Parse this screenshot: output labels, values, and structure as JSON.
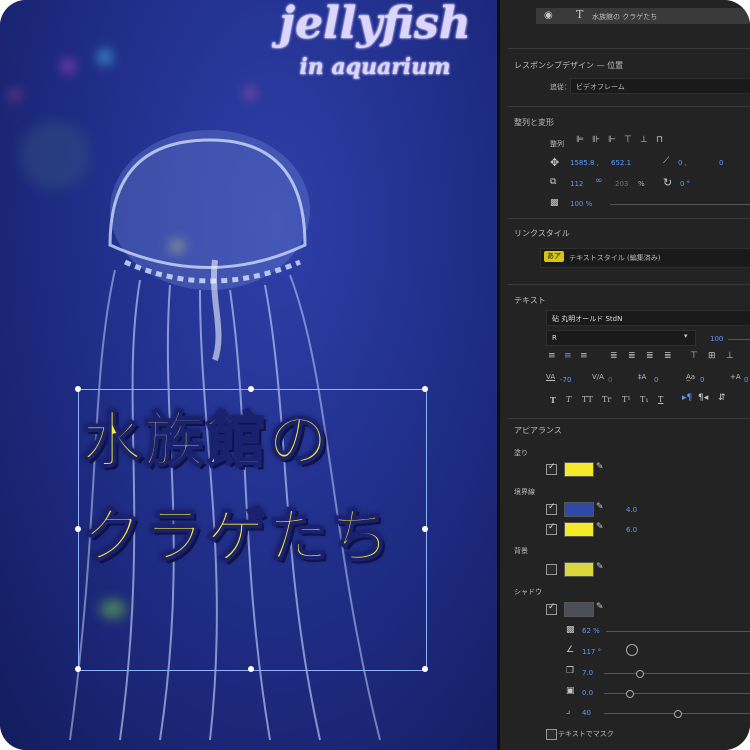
{
  "preview": {
    "logo_title": "jellyfish",
    "logo_subtitle": "in aquarium",
    "caption_line1": "水族館の",
    "caption_line2": "クラゲたち"
  },
  "layer": {
    "name": "水族館の クラゲたち",
    "type_icon": "T"
  },
  "responsive": {
    "title": "レスポンシブデザイン — 位置",
    "follow_label": "追従：",
    "follow_value": "ビデオフレーム"
  },
  "transform": {
    "title": "整列と変形",
    "align_label": "整列",
    "pos_x": "1585.8 ,",
    "pos_y": "652.1",
    "anchor_x": "0 ,",
    "anchor_y": "0",
    "scale_w": "112",
    "scale_h": "203",
    "scale_unit": "%",
    "rotation": "0 °",
    "opacity": "100 %"
  },
  "link_style": {
    "title": "リンクスタイル",
    "badge": "あア",
    "style_name": "テキストスタイル (編集済み)"
  },
  "text": {
    "title": "テキスト",
    "font_family": "砧 丸明オールド StdN",
    "font_style": "R",
    "font_size": "100",
    "tracking": "-70",
    "kerning": "0",
    "leading": "0",
    "baseline": "0",
    "tsume": "0",
    "style_buttons": [
      "T",
      "T",
      "TT",
      "Tr",
      "T¹",
      "T₁",
      "T"
    ]
  },
  "appearance": {
    "title": "アピアランス",
    "fill_label": "塗り",
    "stroke_label": "境界線",
    "stroke1_width": "4.0",
    "stroke2_width": "6.0",
    "background_label": "背景",
    "shadow_label": "シャドウ",
    "shadow_opacity": "62 %",
    "shadow_angle": "117 °",
    "shadow_distance": "7.0",
    "shadow_size": "0.0",
    "shadow_blur": "40",
    "mask_label": "テキストでマスク"
  },
  "colors": {
    "fill": "#f5ea2a",
    "stroke1": "#2d4aa8",
    "stroke2": "#f5ea2a",
    "background": "#d9d73c",
    "shadow": "#4a4f57",
    "caption": "#f7ee3a"
  },
  "checks": {
    "fill": true,
    "stroke1": true,
    "stroke2": true,
    "background": false,
    "shadow": true,
    "mask": false
  },
  "icons": {
    "visibility": "eye-icon",
    "type": "text-layer-icon",
    "position": "move-icon",
    "anchor": "anchor-icon",
    "scale": "scale-icon",
    "link": "link-icon",
    "rotation": "rotation-icon",
    "opacity": "opacity-icon",
    "eyedropper": "eyedropper-icon"
  }
}
